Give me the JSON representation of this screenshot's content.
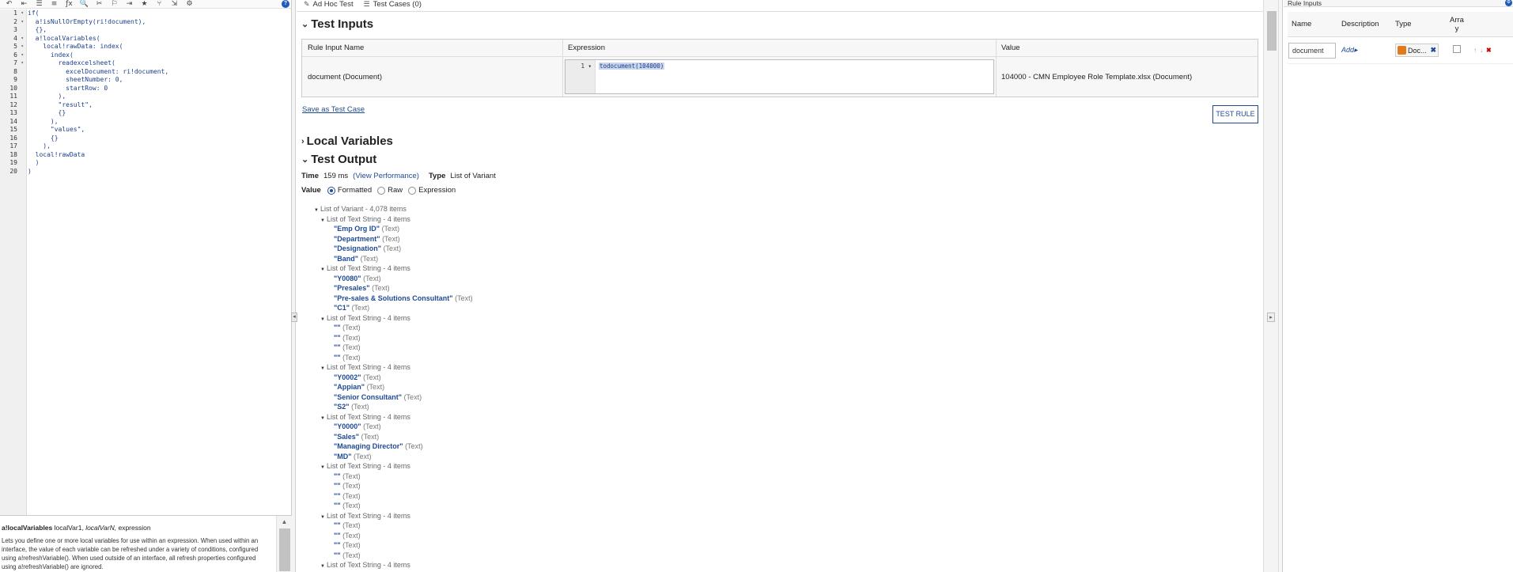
{
  "editor": {
    "toolbar_icons": [
      "↶",
      "⇤",
      "☰",
      "≡",
      "ƒx",
      "🔍",
      "✂",
      "⚐",
      "⇥",
      "★",
      "⑂",
      "⇲",
      "⚙"
    ],
    "help_label": "?",
    "line_numbers": [
      "1",
      "2",
      "3",
      "4",
      "5",
      "6",
      "7",
      "8",
      "9",
      "10",
      "11",
      "12",
      "13",
      "14",
      "15",
      "16",
      "17",
      "18",
      "19",
      "20"
    ],
    "code_lines": [
      "if(",
      "  a!isNullOrEmpty(ri!document),",
      "  {},",
      "  a!localVariables(",
      "    local!rawData: index(",
      "      index(",
      "        readexcelsheet(",
      "          excelDocument: ri!document,",
      "          sheetNumber: 0,",
      "          startRow: 0",
      "        ),",
      "        \"result\",",
      "        {}",
      "      ),",
      "      \"values\",",
      "      {}",
      "    ),",
      "  local!rawData",
      "  )",
      ")"
    ]
  },
  "docs": {
    "function_name": "a!localVariables",
    "signature_args": "localVar1,",
    "signature_italic": "localVarN,",
    "signature_rest": "expression",
    "description": "Lets you define one or more local variables for use within an expression. When used within an interface, the value of each variable can be refreshed under a variety of conditions, configured using a!refreshVariable(). When used outside of an interface, all refresh properties configured using a!refreshVariable() are ignored."
  },
  "center": {
    "tabs": [
      {
        "icon": "✎",
        "label": "Ad Hoc Test"
      },
      {
        "icon": "☰",
        "label": "Test Cases (0)"
      }
    ],
    "test_inputs": {
      "heading": "Test Inputs",
      "col_name": "Rule Input Name",
      "col_expression": "Expression",
      "col_value": "Value",
      "row_name": "document (Document)",
      "row_line_no": "1",
      "row_expression": "todocument(104000)",
      "row_value": "104000 - CMN Employee Role Template.xlsx (Document)"
    },
    "save_test_case": "Save as Test Case",
    "test_rule_button": "TEST RULE",
    "local_variables_heading": "Local Variables",
    "test_output_heading": "Test Output",
    "time_label": "Time",
    "time_value": "159 ms",
    "view_performance": "(View Performance)",
    "type_label": "Type",
    "type_value": "List of Variant",
    "value_label": "Value",
    "value_options": [
      "Formatted",
      "Raw",
      "Expression"
    ],
    "selected_value_option": "Formatted",
    "tree": {
      "root": "List of Variant - 4,078 items",
      "group_label": "List of Text String - 4 items",
      "type_suffix": "(Text)",
      "groups": [
        [
          "\"Emp Org ID\"",
          "\"Department\"",
          "\"Designation\"",
          "\"Band\""
        ],
        [
          "\"Y0080\"",
          "\"Presales\"",
          "\"Pre-sales & Solutions Consultant\"",
          "\"C1\""
        ],
        [
          "\"\"",
          "\"\"",
          "\"\"",
          "\"\""
        ],
        [
          "\"Y0002\"",
          "\"Appian\"",
          "\"Senior Consultant\"",
          "\"S2\""
        ],
        [
          "\"Y0000\"",
          "\"Sales\"",
          "\"Managing Director\"",
          "\"MD\""
        ],
        [
          "\"\"",
          "\"\"",
          "\"\"",
          "\"\""
        ],
        [
          "\"\"",
          "\"\"",
          "\"\"",
          "\"\""
        ],
        []
      ]
    }
  },
  "rule_inputs": {
    "title": "Rule Inputs",
    "col_name": "Name",
    "col_description": "Description",
    "col_type": "Type",
    "col_array": "Array",
    "row_name": "document",
    "row_description": "Add",
    "row_type": "Doc..."
  },
  "colors": {
    "accent": "#1e4a94",
    "link": "#1e4a94",
    "delete": "#cc0000",
    "document_type": "#e07a1a"
  }
}
